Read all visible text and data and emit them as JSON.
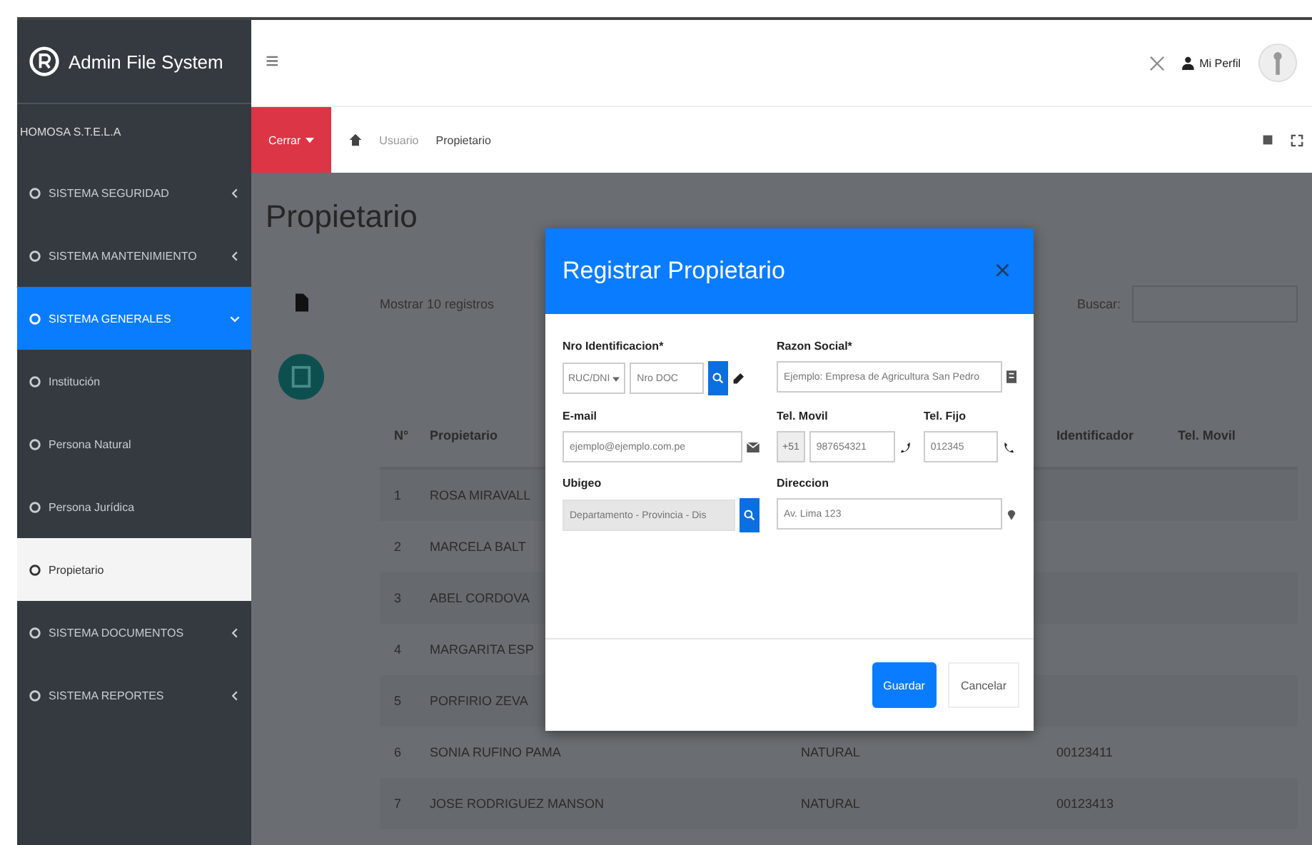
{
  "sidebar": {
    "brand": "Admin File System",
    "user": "HOMOSA S.T.E.L.A",
    "items": [
      {
        "label": "SISTEMA SEGURIDAD",
        "selected": false,
        "expanded": false
      },
      {
        "label": "SISTEMA MANTENIMIENTO",
        "selected": false,
        "expanded": false
      },
      {
        "label": "SISTEMA GENERALES",
        "selected": true,
        "expanded": true,
        "children": [
          {
            "label": "Institución",
            "selected": false
          },
          {
            "label": "Persona Natural",
            "selected": false
          },
          {
            "label": "Persona Jurídica",
            "selected": false
          },
          {
            "label": "Propietario",
            "selected": true
          }
        ]
      },
      {
        "label": "SISTEMA DOCUMENTOS",
        "selected": false,
        "expanded": false
      },
      {
        "label": "SISTEMA REPORTES",
        "selected": false,
        "expanded": false
      }
    ]
  },
  "topbar": {
    "menu": "≡",
    "profile": "Mi Perfil"
  },
  "breadcrumb": {
    "button": "Cerrar",
    "items": [
      "Usuario",
      "Propietario"
    ]
  },
  "page": {
    "title": "Propietario",
    "length_label": "Mostrar 10 registros",
    "search_label": "Buscar:"
  },
  "table": {
    "columns": [
      {
        "label": "N°"
      },
      {
        "label": "Propietario"
      },
      {},
      {
        "label": "Identificador"
      },
      {
        "label": "Tel. Movil"
      }
    ],
    "rows": [
      {
        "num": "1",
        "name": "ROSA MIRAVALL"
      },
      {
        "num": "2",
        "name": "MARCELA BALT"
      },
      {
        "num": "3",
        "name": "ABEL CORDOVA"
      },
      {
        "num": "4",
        "name": "MARGARITA ESP"
      },
      {
        "num": "5",
        "name": "PORFIRIO ZEVA"
      },
      {
        "num": "6",
        "name": "SONIA RUFINO PAMA",
        "type": "NATURAL",
        "id": "00123411"
      },
      {
        "num": "7",
        "name": "JOSE RODRIGUEZ MANSON",
        "type": "NATURAL",
        "id": "00123413"
      }
    ]
  },
  "modal": {
    "title": "Registrar Propietario",
    "close": "×",
    "id_label": "Nro Identificacion*",
    "id_type": "RUC/DNI",
    "id_placeholder": "Nro DOC",
    "razon_label": "Razon Social*",
    "razon_placeholder": "Ejemplo: Empresa de Agricultura San Pedro",
    "email_label": "E-mail",
    "email_placeholder": "ejemplo@ejemplo.com.pe",
    "movil_label": "Tel. Movil",
    "movil_prefix": "+51",
    "movil_placeholder": "987654321",
    "fijo_label": "Tel. Fijo",
    "fijo_placeholder": "012345",
    "ubigeo_label": "Ubigeo",
    "ubigeo_placeholder": "Departamento - Provincia - Dis",
    "ubigeo_disabled": true,
    "direccion_label": "Direccion",
    "direccion_placeholder": "Av. Lima 123",
    "buttons": [
      {
        "label": "Guardar",
        "kind": "primary"
      },
      {
        "label": "Cancelar",
        "kind": "default"
      }
    ]
  }
}
